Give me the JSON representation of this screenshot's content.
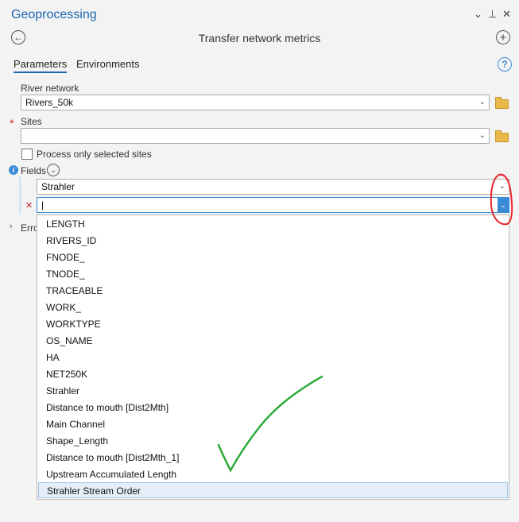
{
  "pane": {
    "title": "Geoprocessing",
    "controls": {
      "dropdown": "⌄",
      "pin": "⊥",
      "close": "✕"
    }
  },
  "tool": {
    "title": "Transfer network metrics",
    "back_icon": "←",
    "add_icon": "+"
  },
  "tabs": [
    {
      "label": "Parameters",
      "active": true
    },
    {
      "label": "Environments",
      "active": false
    }
  ],
  "help_icon": "?",
  "params": {
    "river_network": {
      "label": "River network",
      "value": "Rivers_50k"
    },
    "sites": {
      "label": "Sites",
      "required_marker": "*",
      "value": ""
    },
    "process_selected": {
      "label": "Process only selected sites",
      "checked": false
    },
    "fields": {
      "label": "Fields",
      "expand_icon": "⌄",
      "row1_value": "Strahler",
      "row2_value": "|",
      "remove_icon": "✕"
    },
    "errors_label_partial": "Erro"
  },
  "dropdown_options": [
    "LENGTH",
    "RIVERS_ID",
    "FNODE_",
    "TNODE_",
    "TRACEABLE",
    "WORK_",
    "WORKTYPE",
    "OS_NAME",
    "HA",
    "NET250K",
    "Strahler",
    "Distance to mouth [Dist2Mth]",
    "Main Channel",
    "Shape_Length",
    "Distance to mouth [Dist2Mth_1]",
    "Upstream Accumulated Length",
    "Strahler Stream Order"
  ],
  "selected_option": "Strahler Stream Order",
  "colors": {
    "accent": "#1a64b4",
    "annotation_red": "#e8252b",
    "annotation_green": "#2eaa3a"
  }
}
